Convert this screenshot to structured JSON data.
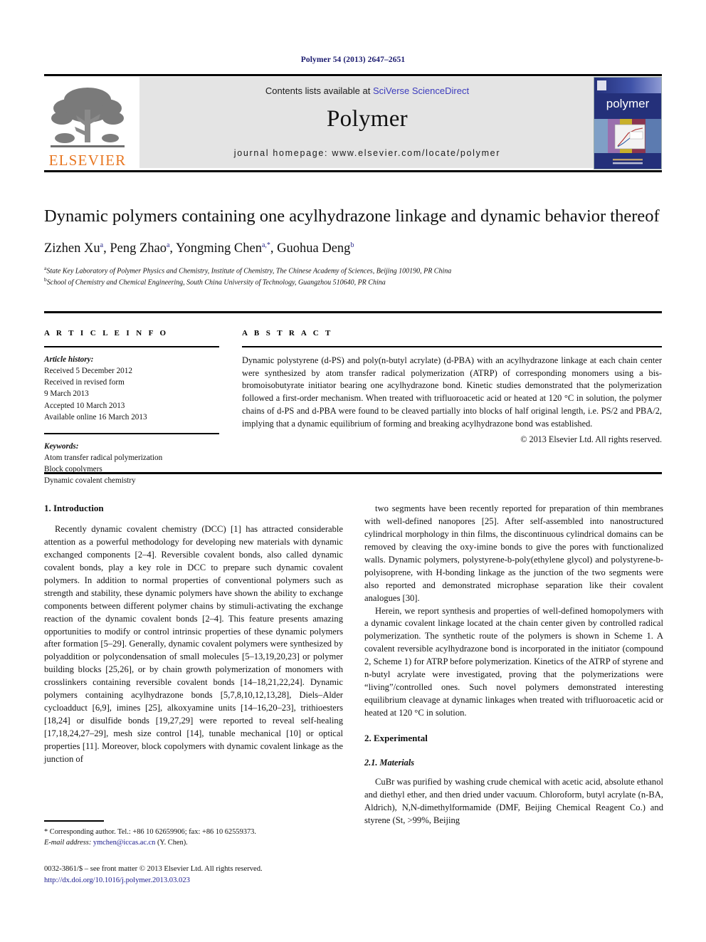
{
  "running_head": "Polymer 54 (2013) 2647–2651",
  "masthead": {
    "publisher_name": "ELSEVIER",
    "publisher_logo_icon": "elsevier-tree-icon",
    "contents_prefix": "Contents lists available at ",
    "contents_link": "SciVerse ScienceDirect",
    "journal_title": "Polymer",
    "homepage_line": "journal homepage: www.elsevier.com/locate/polymer",
    "cover_word": "polymer",
    "cover_icon": "journal-cover-thumbnail"
  },
  "article": {
    "title": "Dynamic polymers containing one acylhydrazone linkage and dynamic behavior thereof",
    "authors": [
      {
        "name": "Zizhen Xu",
        "sup": "a"
      },
      {
        "name": "Peng Zhao",
        "sup": "a"
      },
      {
        "name": "Yongming Chen",
        "sup": "a,*"
      },
      {
        "name": "Guohua Deng",
        "sup": "b"
      }
    ],
    "authors_line": "Zizhen Xu a, Peng Zhao a, Yongming Chen a,*, Guohua Deng b",
    "affiliations": [
      {
        "sup": "a",
        "text": "State Key Laboratory of Polymer Physics and Chemistry, Institute of Chemistry, The Chinese Academy of Sciences, Beijing 100190, PR China"
      },
      {
        "sup": "b",
        "text": "School of Chemistry and Chemical Engineering, South China University of Technology, Guangzhou 510640, PR China"
      }
    ]
  },
  "article_info": {
    "heading": "A R T I C L E  I N F O",
    "history_label": "Article history:",
    "history": [
      "Received 5 December 2012",
      "Received in revised form",
      "9 March 2013",
      "Accepted 10 March 2013",
      "Available online 16 March 2013"
    ],
    "keywords_label": "Keywords:",
    "keywords": [
      "Atom transfer radical polymerization",
      "Block copolymers",
      "Dynamic covalent chemistry"
    ]
  },
  "abstract": {
    "heading": "A B S T R A C T",
    "body": "Dynamic polystyrene (d-PS) and poly(n-butyl acrylate) (d-PBA) with an acylhydrazone linkage at each chain center were synthesized by atom transfer radical polymerization (ATRP) of corresponding monomers using a bis-bromoisobutyrate initiator bearing one acylhydrazone bond. Kinetic studies demonstrated that the polymerization followed a first-order mechanism. When treated with trifluoroacetic acid or heated at 120 °C in solution, the polymer chains of d-PS and d-PBA were found to be cleaved partially into blocks of half original length, i.e. PS/2 and PBA/2, implying that a dynamic equilibrium of forming and breaking acylhydrazone bond was established.",
    "copyright": "© 2013 Elsevier Ltd. All rights reserved."
  },
  "body": {
    "left_column": {
      "heading": "1. Introduction",
      "paragraph1": "Recently dynamic covalent chemistry (DCC) [1] has attracted considerable attention as a powerful methodology for developing new materials with dynamic exchanged components [2–4]. Reversible covalent bonds, also called dynamic covalent bonds, play a key role in DCC to prepare such dynamic covalent polymers. In addition to normal properties of conventional polymers such as strength and stability, these dynamic polymers have shown the ability to exchange components between different polymer chains by stimuli-activating the exchange reaction of the dynamic covalent bonds [2–4]. This feature presents amazing opportunities to modify or control intrinsic properties of these dynamic polymers after formation [5–29]. Generally, dynamic covalent polymers were synthesized by polyaddition or polycondensation of small molecules [5–13,19,20,23] or polymer building blocks [25,26], or by chain growth polymerization of monomers with crosslinkers containing reversible covalent bonds [14–18,21,22,24]. Dynamic polymers containing acylhydrazone bonds [5,7,8,10,12,13,28], Diels–Alder cycloadduct [6,9], imines [25], alkoxyamine units [14–16,20–23], trithioesters [18,24] or disulfide bonds [19,27,29] were reported to reveal self-healing [17,18,24,27–29], mesh size control [14], tunable mechanical [10] or optical properties [11]. Moreover, block copolymers with dynamic covalent linkage as the junction of"
    },
    "right_column": {
      "paragraph1": "two segments have been recently reported for preparation of thin membranes with well-defined nanopores [25]. After self-assembled into nanostructured cylindrical morphology in thin films, the discontinuous cylindrical domains can be removed by cleaving the oxy-imine bonds to give the pores with functionalized walls. Dynamic polymers, polystyrene-b-poly(ethylene glycol) and polystyrene-b-polyisoprene, with H-bonding linkage as the junction of the two segments were also reported and demonstrated microphase separation like their covalent analogues [30].",
      "paragraph2": "Herein, we report synthesis and properties of well-defined homopolymers with a dynamic covalent linkage located at the chain center given by controlled radical polymerization. The synthetic route of the polymers is shown in Scheme 1. A covalent reversible acylhydrazone bond is incorporated in the initiator (compound 2, Scheme 1) for ATRP before polymerization. Kinetics of the ATRP of styrene and n-butyl acrylate were investigated, proving that the polymerizations were “living”/controlled ones. Such novel polymers demonstrated interesting equilibrium cleavage at dynamic linkages when treated with trifluoroacetic acid or heated at 120 °C in solution.",
      "heading2": "2. Experimental",
      "subheading21": "2.1. Materials",
      "paragraph3": "CuBr was purified by washing crude chemical with acetic acid, absolute ethanol and diethyl ether, and then dried under vacuum. Chloroform, butyl acrylate (n-BA, Aldrich), N,N-dimethylformamide (DMF, Beijing Chemical Reagent Co.) and styrene (St, >99%, Beijing"
    }
  },
  "footnote": {
    "corresponding": "* Corresponding author. Tel.: +86 10 62659906; fax: +86 10 62559373.",
    "email_label": "E-mail address:",
    "email": "ymchen@iccas.ac.cn",
    "email_suffix": " (Y. Chen)."
  },
  "bottom_matter": {
    "issn_line": "0032-3861/$ – see front matter © 2013 Elsevier Ltd. All rights reserved.",
    "doi": "http://dx.doi.org/10.1016/j.polymer.2013.03.023"
  },
  "colors": {
    "link_blue": "#1a1a8c",
    "sciencedirect_blue": "#3b3bbd",
    "elsevier_orange": "#E87722",
    "running_head_blue": "#1a1a6e",
    "band_gray": "#e4e4e4",
    "cover_blue": "#2b3c8e"
  }
}
